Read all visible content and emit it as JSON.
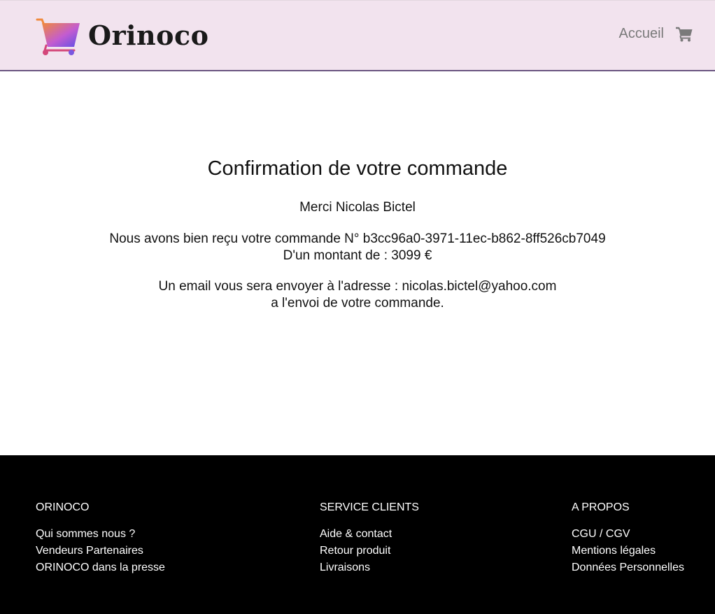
{
  "header": {
    "logo_text": "Orinoco",
    "nav_home": "Accueil",
    "cart_icon": "shopping-cart-icon",
    "logo_icon": "shopping-cart-gradient-icon",
    "background_color": "#f2e3ee",
    "border_color": "#6a5580"
  },
  "confirmation": {
    "title": "Confirmation de votre commande",
    "thanks": "Merci Nicolas Bictel",
    "order_line": "Nous avons bien reçu votre commande N° b3cc96a0-3971-11ec-b862-8ff526cb7049",
    "amount_line": "D'un montant de : 3099 €",
    "email_line": "Un email vous sera envoyer à l'adresse : nicolas.bictel@yahoo.com",
    "shipping_line": "a l'envoi de votre commande."
  },
  "footer": {
    "background_color": "#000000",
    "columns": [
      {
        "title": "ORINOCO",
        "links": [
          "Qui sommes nous ?",
          "Vendeurs Partenaires",
          "ORINOCO dans la presse"
        ]
      },
      {
        "title": "SERVICE CLIENTS",
        "links": [
          "Aide & contact",
          "Retour produit",
          "Livraisons"
        ]
      },
      {
        "title": "A PROPOS",
        "links": [
          "CGU / CGV",
          "Mentions légales",
          "Données Personnelles"
        ]
      }
    ]
  }
}
